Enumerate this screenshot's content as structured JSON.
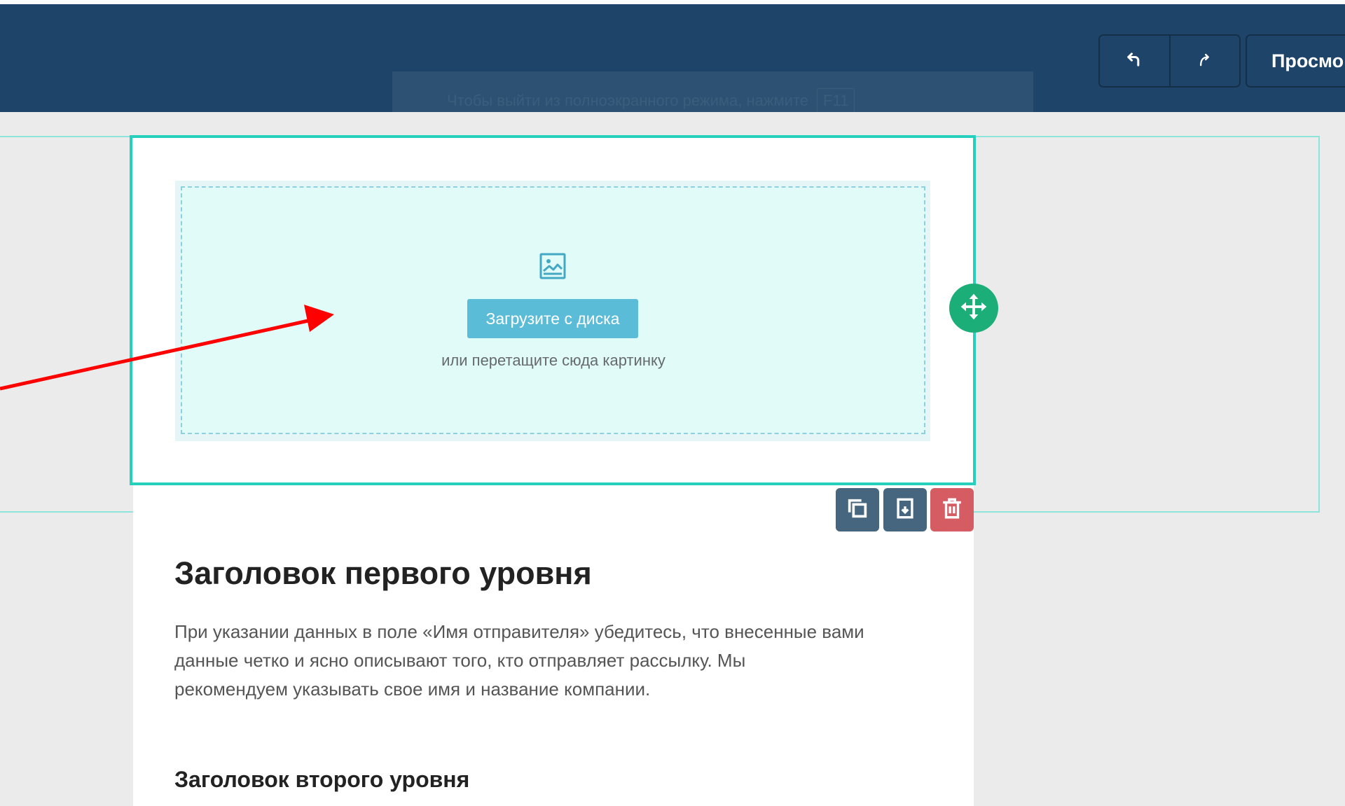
{
  "header": {
    "undo_icon": "undo-icon",
    "redo_icon": "redo-icon",
    "preview_label": "Просмо"
  },
  "ghost_tooltip": {
    "text": "Чтобы выйти из полноэкранного режима, нажмите",
    "key": "F11"
  },
  "image_block": {
    "icon": "image-icon",
    "upload_label": "Загрузите с диска",
    "hint": "или перетащите сюда картинку",
    "move_icon": "move-icon"
  },
  "block_toolbar": {
    "copy_icon": "copy-icon",
    "save_icon": "save-icon",
    "delete_icon": "trash-icon"
  },
  "content": {
    "h1": "Заголовок первого уровня",
    "paragraph_lines": [
      "При указании данных в поле «Имя отправителя» убедитесь, что внесенные вами",
      "данные четко и ясно описывают того, кто отправляет рассылку. Мы",
      "рекомендуем указывать свое имя и название компании."
    ],
    "h2": "Заголовок второго уровня"
  },
  "colors": {
    "header_bg": "#1e4569",
    "selection": "#26d0bd",
    "upload_button": "#5bbcd8",
    "move_handle": "#1bae79",
    "delete_tool": "#d45c62",
    "tool": "#46667f",
    "annotation_arrow": "#ff0000"
  }
}
